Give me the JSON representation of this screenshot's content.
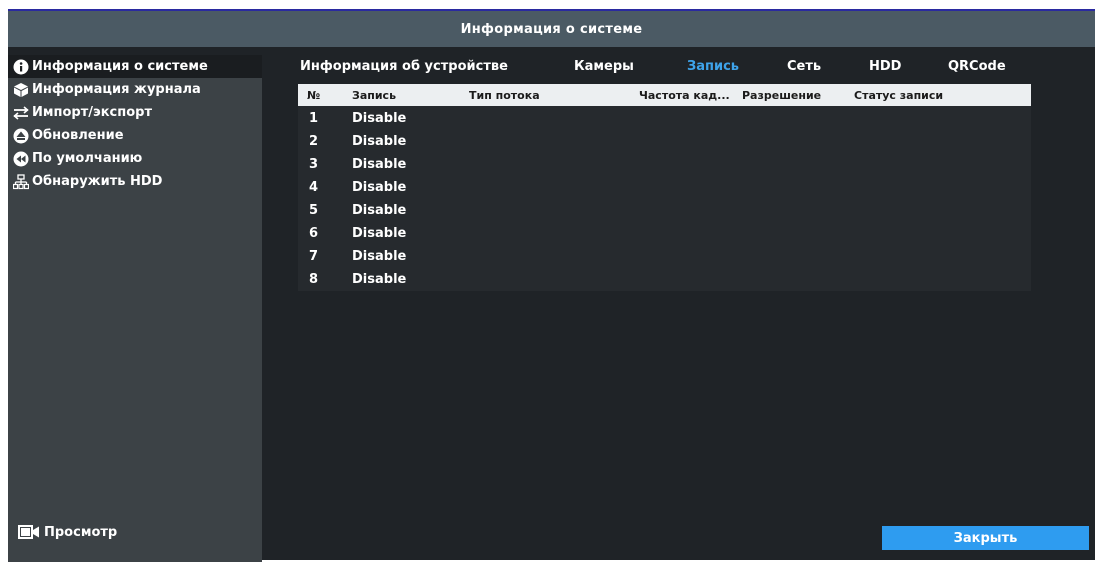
{
  "window": {
    "title": "Информация о системе"
  },
  "sidebar": {
    "items": [
      {
        "label": "Информация о системе",
        "icon": "info-icon",
        "active": true
      },
      {
        "label": "Информация журнала",
        "icon": "cube-icon",
        "active": false
      },
      {
        "label": "Импорт/экспорт",
        "icon": "import-export-icon",
        "active": false
      },
      {
        "label": "Обновление",
        "icon": "upload-icon",
        "active": false
      },
      {
        "label": "По умолчанию",
        "icon": "reset-icon",
        "active": false
      },
      {
        "label": "Обнаружить HDD",
        "icon": "network-icon",
        "active": false
      }
    ],
    "preview_label": "Просмотр"
  },
  "tabs": [
    {
      "label": "Информация об устройстве",
      "active": false
    },
    {
      "label": "Камеры",
      "active": false
    },
    {
      "label": "Запись",
      "active": true
    },
    {
      "label": "Сеть",
      "active": false
    },
    {
      "label": "HDD",
      "active": false
    },
    {
      "label": "QRCode",
      "active": false
    }
  ],
  "table": {
    "headers": [
      "№",
      "Запись",
      "Тип потока",
      "Частота кад...",
      "Разрешение",
      "Статус записи"
    ],
    "rows": [
      {
        "no": "1",
        "record": "Disable"
      },
      {
        "no": "2",
        "record": "Disable"
      },
      {
        "no": "3",
        "record": "Disable"
      },
      {
        "no": "4",
        "record": "Disable"
      },
      {
        "no": "5",
        "record": "Disable"
      },
      {
        "no": "6",
        "record": "Disable"
      },
      {
        "no": "7",
        "record": "Disable"
      },
      {
        "no": "8",
        "record": "Disable"
      }
    ]
  },
  "buttons": {
    "close_label": "Закрыть"
  },
  "colors": {
    "accent": "#3ea3ea",
    "button": "#2e9cf0",
    "titlebar": "#4b5a64",
    "background": "#1f2327",
    "sidebar": "#3c4246"
  }
}
